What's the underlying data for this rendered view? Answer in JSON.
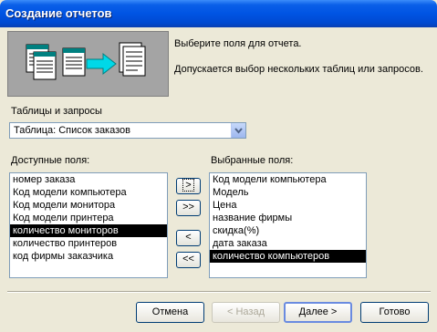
{
  "window": {
    "title": "Создание отчетов"
  },
  "intro": {
    "line1": "Выберите поля для отчета.",
    "line2": "Допускается выбор нескольких таблиц или запросов."
  },
  "source": {
    "label": "Таблицы и запросы",
    "selected": "Таблица: Список заказов"
  },
  "available": {
    "label": "Доступные поля:",
    "items": [
      "номер заказа",
      "Код модели компьютера",
      "Код модели монитора",
      "Код модели принтера",
      "количество мониторов",
      "количество принтеров",
      "код фирмы заказчика"
    ],
    "selected_index": 4
  },
  "chosen": {
    "label": "Выбранные поля:",
    "items": [
      "Код модели компьютера",
      "Модель",
      "Цена",
      "название фирмы",
      "скидка(%)",
      "дата заказа",
      "количество компьютеров"
    ],
    "selected_index": 6
  },
  "move_buttons": {
    "add_one": ">",
    "add_all": ">>",
    "remove_one": "<",
    "remove_all": "<<"
  },
  "footer": {
    "cancel": "Отмена",
    "back": "< Назад",
    "next": "Далее >",
    "finish": "Готово"
  },
  "colors": {
    "titlebar": "#0054E3",
    "dialog": "#ECE9D8",
    "selection": "#000000"
  }
}
